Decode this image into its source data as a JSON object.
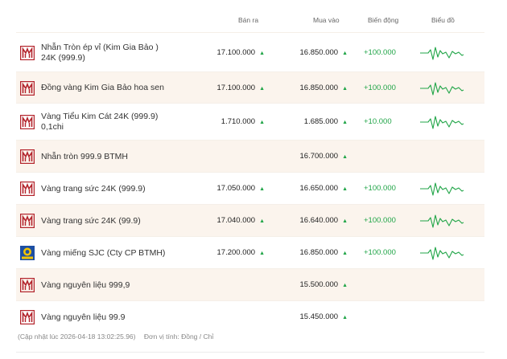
{
  "header": {
    "sell": "Bán ra",
    "buy": "Mua vào",
    "change": "Biến động",
    "chart": "Biểu đồ"
  },
  "colors": {
    "brand_red": "#b3232b",
    "up_green": "#21a548",
    "row_tint": "#fbf4ed",
    "sjc_blue": "#1d4fa3",
    "sjc_yellow": "#f2c300"
  },
  "rows": [
    {
      "name": "Nhẫn Tròn ép vỉ (Kim Gia Bảo ) 24K (999.9)",
      "sell": "17.100.000",
      "buy": "16.850.000",
      "change": "+100.000",
      "logo": "btmh-logo-icon"
    },
    {
      "name": "Đồng vàng Kim Gia Bảo hoa sen",
      "sell": "17.100.000",
      "buy": "16.850.000",
      "change": "+100.000",
      "logo": "btmh-logo-icon"
    },
    {
      "name": "Vàng Tiểu Kim Cát 24K (999.9) 0,1chi",
      "sell": "1.710.000",
      "buy": "1.685.000",
      "change": "+10.000",
      "logo": "btmh-logo-icon"
    },
    {
      "name": "Nhẫn tròn 999.9 BTMH",
      "sell": "",
      "buy": "16.700.000",
      "change": "",
      "logo": "btmh-logo-icon"
    },
    {
      "name": "Vàng trang sức 24K (999.9)",
      "sell": "17.050.000",
      "buy": "16.650.000",
      "change": "+100.000",
      "logo": "btmh-logo-icon"
    },
    {
      "name": "Vàng trang sức 24K (99.9)",
      "sell": "17.040.000",
      "buy": "16.640.000",
      "change": "+100.000",
      "logo": "btmh-logo-icon"
    },
    {
      "name": "Vàng miếng SJC (Cty CP BTMH)",
      "sell": "17.200.000",
      "buy": "16.850.000",
      "change": "+100.000",
      "logo": "sjc-logo-icon"
    },
    {
      "name": "Vàng nguyên liệu 999,9",
      "sell": "",
      "buy": "15.500.000",
      "change": "",
      "logo": "btmh-logo-icon"
    },
    {
      "name": "Vàng nguyên liệu 99.9",
      "sell": "",
      "buy": "15.450.000",
      "change": "",
      "logo": "btmh-logo-icon"
    }
  ],
  "footer": {
    "updated": "(Cập nhật lúc 2026-04-18 13:02:25.96)",
    "unit": "Đơn vị tính: Đồng / Chỉ"
  }
}
